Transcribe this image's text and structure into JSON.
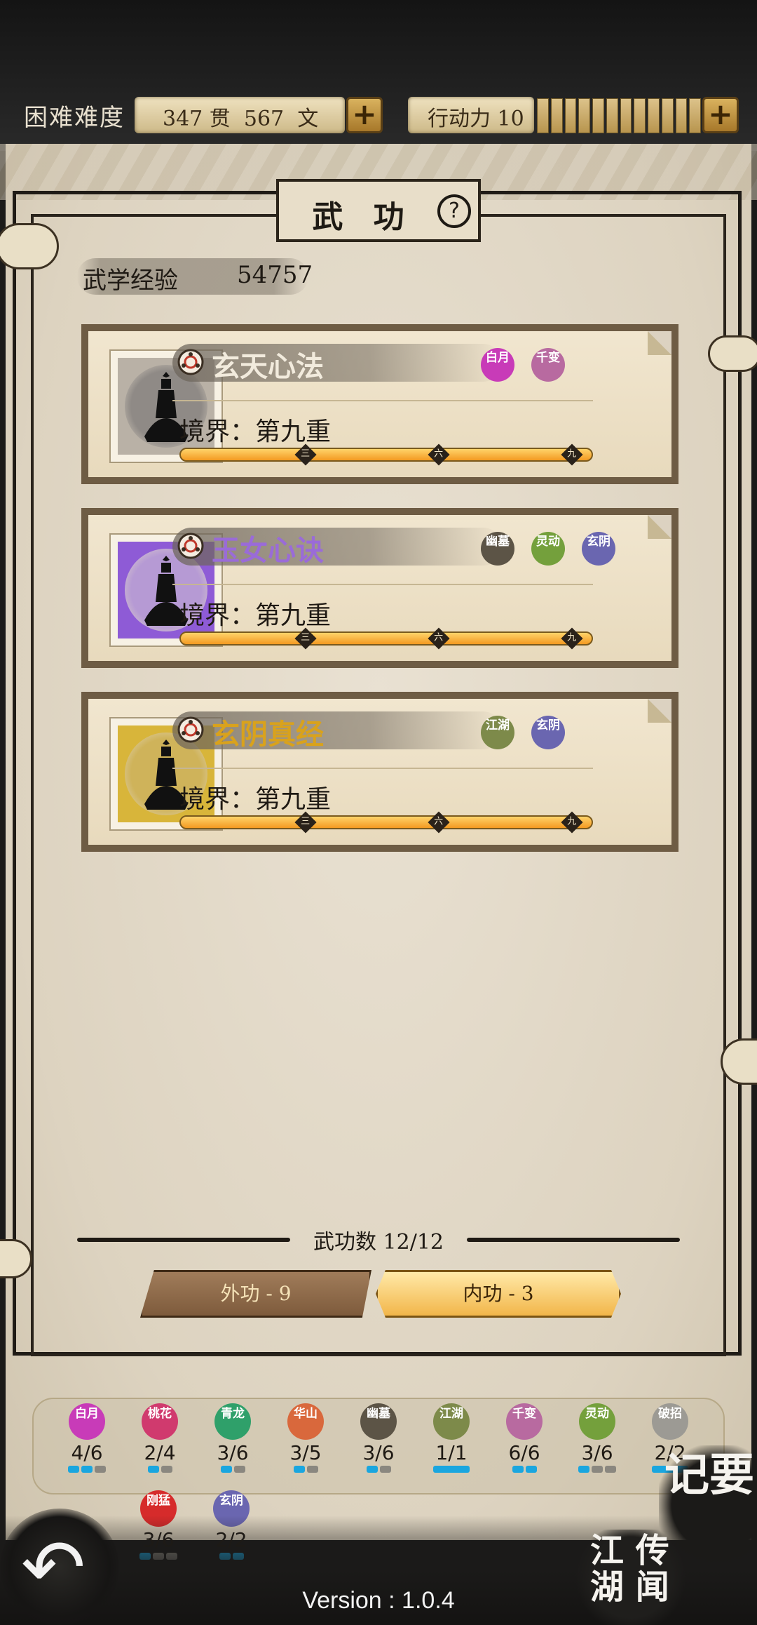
{
  "header": {
    "difficulty": "困难难度",
    "money": "347 贯  567  文",
    "stamina": "行动力 10",
    "stamina_segments": 12,
    "plus_glyph": "+"
  },
  "title": {
    "text": "武 功",
    "help_glyph": "?"
  },
  "experience": {
    "label": "武学经验",
    "value": "54757"
  },
  "skills": [
    {
      "name": "玄天心法",
      "name_color": "#f2ebdd",
      "halo": "#8f8a86",
      "frame": "#b9b1a6",
      "realm": "境界：第九重",
      "progress": 1.0,
      "badges": [
        {
          "text": "白月",
          "color": "#c83bb8"
        },
        {
          "text": "千变",
          "color": "#b86aa0"
        }
      ]
    },
    {
      "name": "玉女心诀",
      "name_color": "#9a6bd8",
      "halo": "#b69ad4",
      "frame": "#8e5bd6",
      "realm": "境界：第九重",
      "progress": 1.0,
      "badges": [
        {
          "text": "幽墓",
          "color": "#5c5446"
        },
        {
          "text": "灵动",
          "color": "#74a03c"
        },
        {
          "text": "玄阴",
          "color": "#6a66b0"
        }
      ]
    },
    {
      "name": "玄阴真经",
      "name_color": "#d9a21c",
      "halo": "#cfb35a",
      "frame": "#d8b53a",
      "realm": "境界：第九重",
      "progress": 1.0,
      "badges": [
        {
          "text": "江湖",
          "color": "#7d8a4a"
        },
        {
          "text": "玄阴",
          "color": "#6a66b0"
        }
      ]
    }
  ],
  "progress_markers": [
    "三",
    "六",
    "九"
  ],
  "skill_count": "武功数 12/12",
  "tabs": {
    "outer": "外功 - 9",
    "inner": "内功 - 3"
  },
  "sects": [
    {
      "text": "白月",
      "color": "#c83bb8",
      "count": "4/6",
      "pips": [
        1,
        1,
        0
      ]
    },
    {
      "text": "桃花",
      "color": "#d03a6e",
      "count": "2/4",
      "pips": [
        1,
        0
      ]
    },
    {
      "text": "青龙",
      "color": "#2fa06a",
      "count": "3/6",
      "pips": [
        1,
        0
      ]
    },
    {
      "text": "华山",
      "color": "#d9683c",
      "count": "3/5",
      "pips": [
        1,
        0
      ]
    },
    {
      "text": "幽墓",
      "color": "#5c5446",
      "count": "3/6",
      "pips": [
        1,
        0
      ]
    },
    {
      "text": "江湖",
      "color": "#7d8a4a",
      "count": "1/1",
      "pips": [
        1
      ]
    },
    {
      "text": "千变",
      "color": "#b86aa0",
      "count": "6/6",
      "pips": [
        1,
        1
      ]
    },
    {
      "text": "灵动",
      "color": "#74a03c",
      "count": "3/6",
      "pips": [
        1,
        0,
        0
      ]
    },
    {
      "text": "破招",
      "color": "#9c9a94",
      "count": "2/2",
      "pips": [
        1
      ]
    },
    {
      "text": "刚猛",
      "color": "#d62b2b",
      "count": "3/6",
      "pips": [
        1,
        0,
        0
      ]
    },
    {
      "text": "玄阴",
      "color": "#6a66b0",
      "count": "2/2",
      "pips": [
        1,
        1
      ]
    }
  ],
  "notes_button": "记要",
  "legends_button": "江 传\n湖 闻",
  "version": "Version : 1.0.4"
}
